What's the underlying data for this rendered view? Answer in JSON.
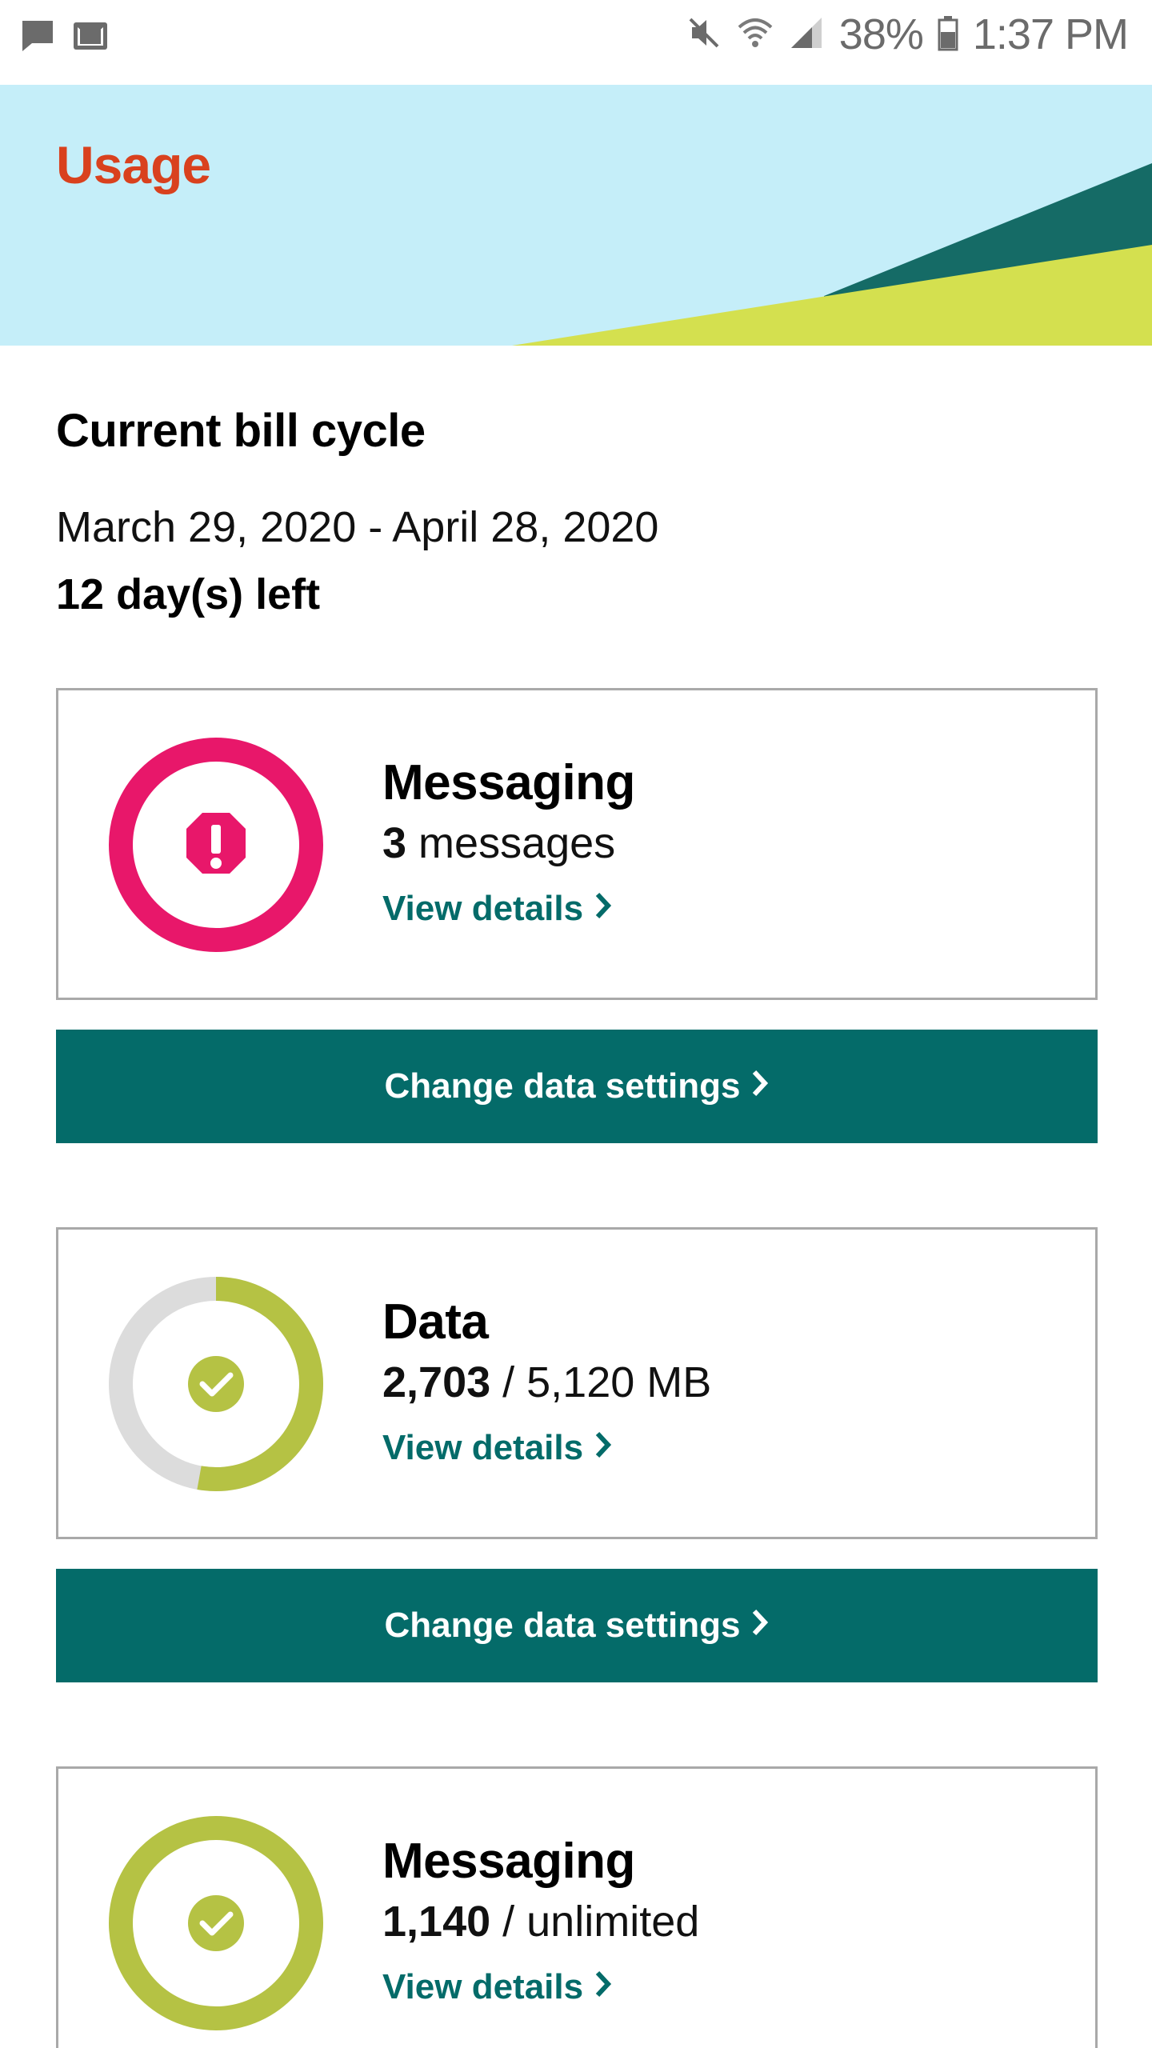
{
  "status_bar": {
    "battery": "38%",
    "time": "1:37 PM",
    "icons": [
      "chat-icon",
      "gmail-icon",
      "mute-icon",
      "wifi-icon",
      "signal-icon",
      "battery-icon"
    ]
  },
  "header": {
    "title": "Usage",
    "title_color": "#d9411e",
    "banner_color": "#c5eef9"
  },
  "bill_cycle": {
    "heading": "Current bill cycle",
    "dates": "March 29, 2020 - April 28, 2020",
    "days_left": "12 day(s) left"
  },
  "usage_cards": [
    {
      "title": "Messaging",
      "value": "3",
      "unit": " messages",
      "link": "View details",
      "status": "alert",
      "ring_color": "#e8176a",
      "ring_fraction": 1.0
    },
    {
      "title": "Data",
      "value": "2,703",
      "unit": " / 5,120 MB",
      "link": "View details",
      "status": "ok",
      "ring_color": "#b5c244",
      "ring_fraction": 0.528
    },
    {
      "title": "Messaging",
      "value": "1,140",
      "unit": " / unlimited",
      "link": "View details",
      "status": "ok",
      "ring_color": "#b5c244",
      "ring_fraction": 1.0
    }
  ],
  "buttons": {
    "change_data_1": "Change data settings",
    "change_data_2": "Change data settings"
  },
  "colors": {
    "accent": "#046b69",
    "lime": "#d4e04f",
    "teal_dark": "#156b66"
  }
}
